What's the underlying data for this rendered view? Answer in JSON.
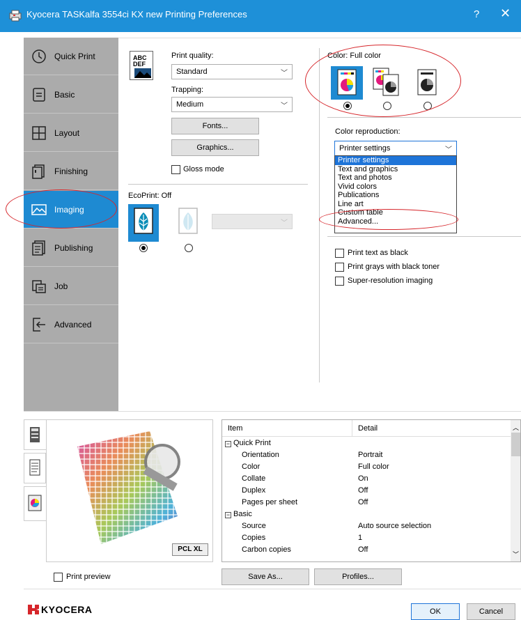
{
  "window": {
    "title": "Kyocera TASKalfa 3554ci KX new Printing Preferences",
    "help": "?",
    "close": "✕"
  },
  "tabs": [
    {
      "label": "Quick Print",
      "icon": "clock-icon"
    },
    {
      "label": "Basic",
      "icon": "document-icon"
    },
    {
      "label": "Layout",
      "icon": "grid-icon"
    },
    {
      "label": "Finishing",
      "icon": "staple-icon"
    },
    {
      "label": "Imaging",
      "icon": "image-icon",
      "active": true
    },
    {
      "label": "Publishing",
      "icon": "publishing-icon"
    },
    {
      "label": "Job",
      "icon": "job-icon"
    },
    {
      "label": "Advanced",
      "icon": "advanced-icon"
    }
  ],
  "imaging": {
    "abc_icon_line1": "ABC",
    "abc_icon_line2": "DEF",
    "print_quality_label": "Print quality:",
    "print_quality_value": "Standard",
    "trapping_label": "Trapping:",
    "trapping_value": "Medium",
    "fonts_button": "Fonts...",
    "graphics_button": "Graphics...",
    "gloss_mode_label": "Gloss mode",
    "ecoprint_label": "EcoPrint:  Off",
    "color_label": "Color:  Full color",
    "color_reproduction_label": "Color reproduction:",
    "color_reproduction_value": "Printer settings",
    "color_reproduction_options": [
      "Printer settings",
      "Text and graphics",
      "Text and photos",
      "Vivid colors",
      "Publications",
      "Line art",
      "Custom table",
      "Advanced..."
    ],
    "print_text_black": "Print text as black",
    "print_grays_black": "Print grays with black toner",
    "super_resolution": "Super-resolution imaging"
  },
  "preview": {
    "pdl_badge": "PCL XL",
    "print_preview_label": "Print preview"
  },
  "summary": {
    "col_item": "Item",
    "col_detail": "Detail",
    "groups": [
      {
        "name": "Quick Print",
        "rows": [
          {
            "item": "Orientation",
            "detail": "Portrait"
          },
          {
            "item": "Color",
            "detail": "Full color"
          },
          {
            "item": "Collate",
            "detail": "On"
          },
          {
            "item": "Duplex",
            "detail": "Off"
          },
          {
            "item": "Pages per sheet",
            "detail": "Off"
          }
        ]
      },
      {
        "name": "Basic",
        "rows": [
          {
            "item": "Source",
            "detail": "Auto source selection"
          },
          {
            "item": "Copies",
            "detail": "1"
          },
          {
            "item": "Carbon copies",
            "detail": "Off"
          }
        ]
      }
    ]
  },
  "footer": {
    "save_as": "Save As...",
    "profiles": "Profiles...",
    "brand": "KYOCERA",
    "ok": "OK",
    "cancel": "Cancel"
  }
}
